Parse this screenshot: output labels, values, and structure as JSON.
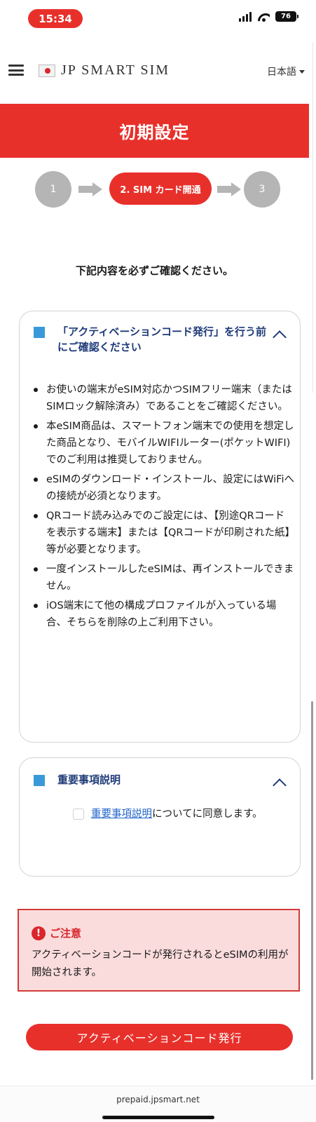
{
  "status_bar": {
    "time": "15:34",
    "battery": "76"
  },
  "header": {
    "logo_text": "JP SMART SIM",
    "language": "日本語"
  },
  "banner": {
    "title": "初期設定"
  },
  "stepper": {
    "step1": "1",
    "step2": "2. SIM カード開通",
    "step3": "3"
  },
  "confirm_heading": "下記内容を必ずご確認ください。",
  "notice_card": {
    "title": "「アクティベーションコード発行」を行う前にご確認ください",
    "items": [
      "お使いの端末がeSIM対応かつSIMフリー端末（またはSIMロック解除済み）であることをご確認ください。",
      "本eSIM商品は、スマートフォン端末での使用を想定した商品となり、モバイルWIFIルーター(ポケットWIFI)でのご利用は推奨しておりません。",
      "eSIMのダウンロード・インストール、設定にはWiFiへの接続が必須となります。",
      "QRコード読み込みでのご設定には、【別途QRコードを表示する端末】または【QRコードが印刷された紙】等が必要となります。",
      "一度インストールしたeSIMは、再インストールできません。",
      "iOS端末にて他の構成プロファイルが入っている場合、そちらを削除の上ご利用下さい。"
    ]
  },
  "important_card": {
    "title": "重要事項説明",
    "agree_link": "重要事項説明",
    "agree_text": "についてに同意します。"
  },
  "caution": {
    "title": "ご注意",
    "body": "アクティベーションコードが発行されるとeSIMの利用が開始されます。"
  },
  "issue_button": "アクティベーションコード発行",
  "bottom_bar": {
    "url": "prepaid.jpsmart.net"
  }
}
